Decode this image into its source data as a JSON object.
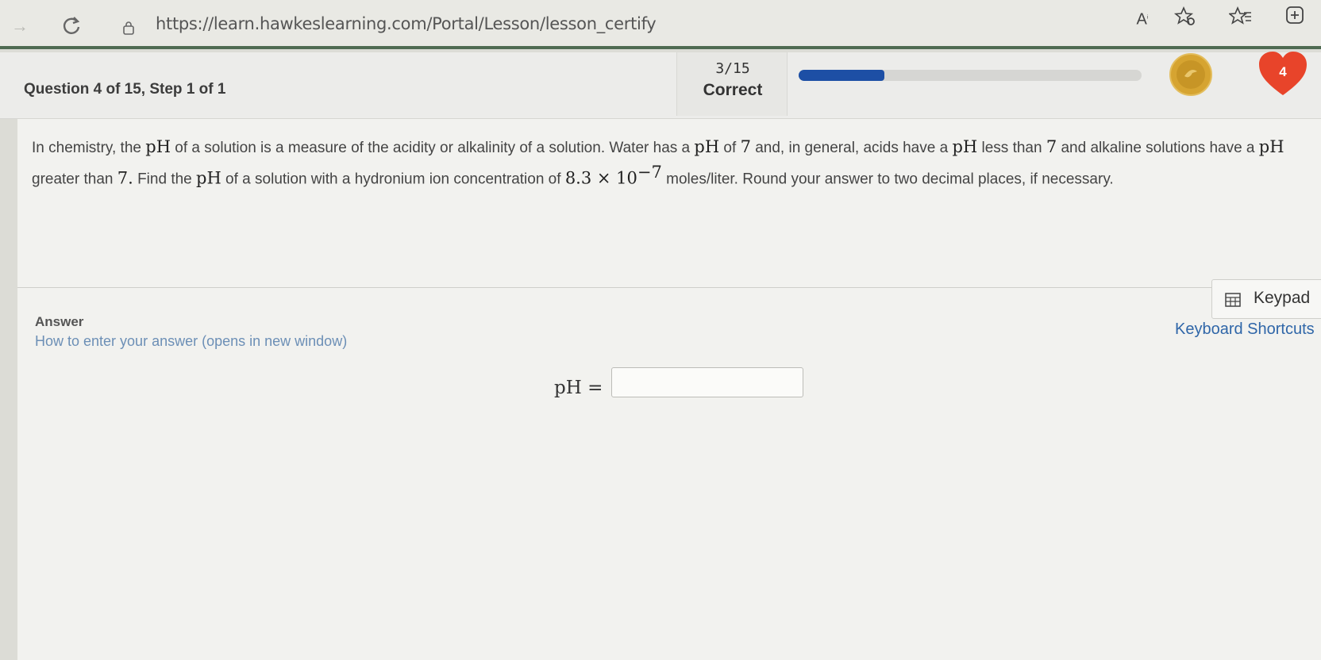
{
  "browser": {
    "url": "https://learn.hawkeslearning.com/Portal/Lesson/lesson_certify",
    "read_aloud_label": "A"
  },
  "header": {
    "question_label": "Question 4 of 15, Step 1 of 1",
    "score_count": "3/15",
    "score_status": "Correct",
    "progress_fraction": 0.25,
    "lives": "4",
    "colors": {
      "progress": "#1d4fa5",
      "heart": "#e8442a",
      "coin": "#d6a431"
    }
  },
  "question": {
    "part1": "In chemistry, the ",
    "ph1": "pH",
    "part2": " of a solution is a measure of the acidity or alkalinity of a solution. Water has a ",
    "ph2": "pH",
    "part3": " of ",
    "seven1": "7",
    "part4": " and, in general, acids have a ",
    "ph3": "pH",
    "part5": " less than ",
    "seven2": "7",
    "part6": " and alkaline solutions have a ",
    "ph4": "pH",
    "part7": " greater than ",
    "seven3": "7.",
    "part8": " Find the ",
    "ph5": "pH",
    "part9": " of a solution with a hydronium ion concentration of ",
    "conc_base": "8.3 × 10",
    "conc_exp": "−7",
    "part10": " moles/liter. Round your answer to two decimal places, if necessary."
  },
  "answer": {
    "label": "Answer",
    "help_link": "How to enter your answer (opens in new window)",
    "keypad_label": "Keypad",
    "shortcuts_label": "Keyboard Shortcuts",
    "ph_label": "pH =",
    "input_value": ""
  }
}
